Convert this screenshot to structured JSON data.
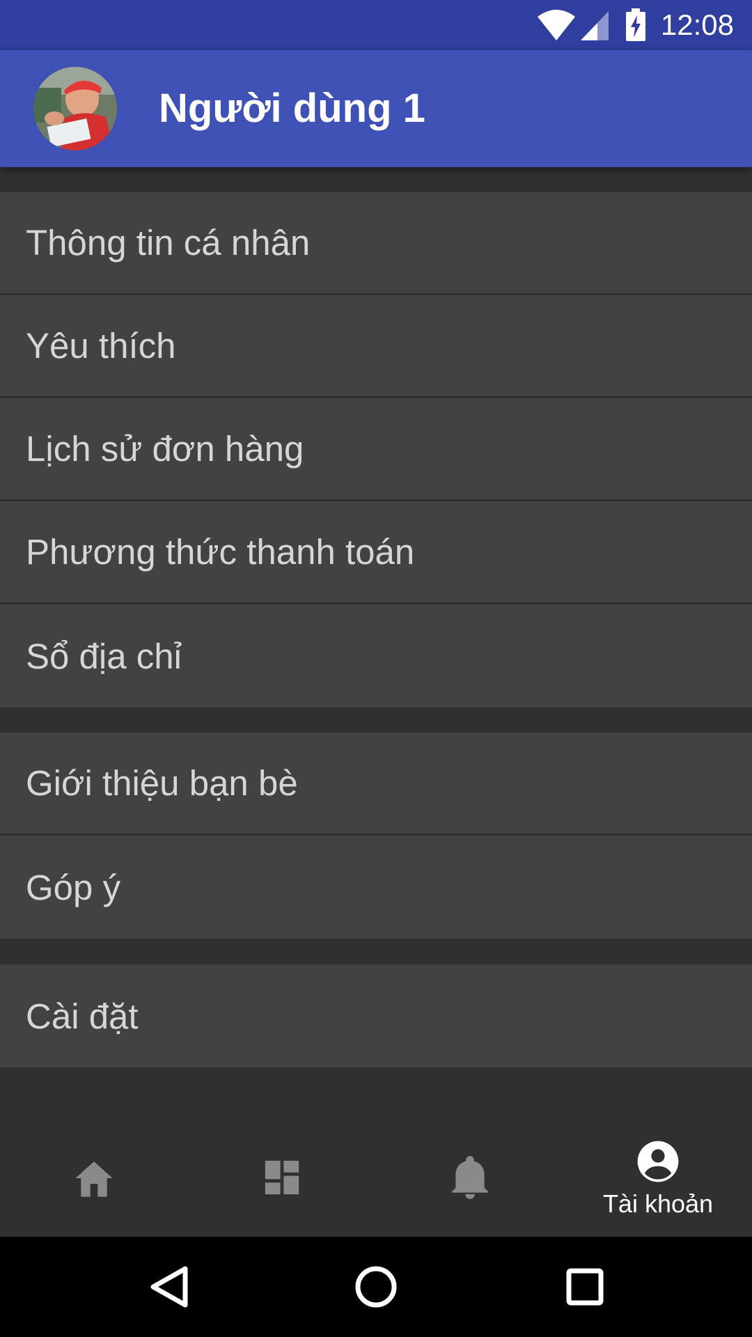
{
  "status_bar": {
    "time": "12:08",
    "icons": [
      "wifi-icon",
      "cell-signal-icon",
      "battery-charging-icon"
    ]
  },
  "header": {
    "avatar": "user-avatar",
    "title": "Người dùng 1"
  },
  "menu_groups": [
    [
      {
        "label": "Thông tin cá nhân"
      },
      {
        "label": "Yêu thích"
      },
      {
        "label": "Lịch sử đơn hàng"
      },
      {
        "label": "Phương thức thanh toán"
      },
      {
        "label": "Sổ địa chỉ"
      }
    ],
    [
      {
        "label": "Giới thiệu bạn bè"
      },
      {
        "label": "Góp ý"
      }
    ],
    [
      {
        "label": "Cài đặt"
      }
    ]
  ],
  "bottom_nav": {
    "items": [
      {
        "icon": "home-icon",
        "label": ""
      },
      {
        "icon": "dashboard-icon",
        "label": ""
      },
      {
        "icon": "bell-icon",
        "label": ""
      },
      {
        "icon": "account-circle-icon",
        "label": "Tài khoản",
        "selected": true
      }
    ]
  },
  "system_nav": [
    "back-icon",
    "home-circle-icon",
    "recents-icon"
  ],
  "colors": {
    "status_bar": "#303f9f",
    "app_bar": "#3f51b5",
    "background": "#303030",
    "menu_item": "#424242",
    "menu_text": "#d6d6d6",
    "nav_inactive": "#8a8a8a",
    "nav_active": "#ffffff"
  }
}
